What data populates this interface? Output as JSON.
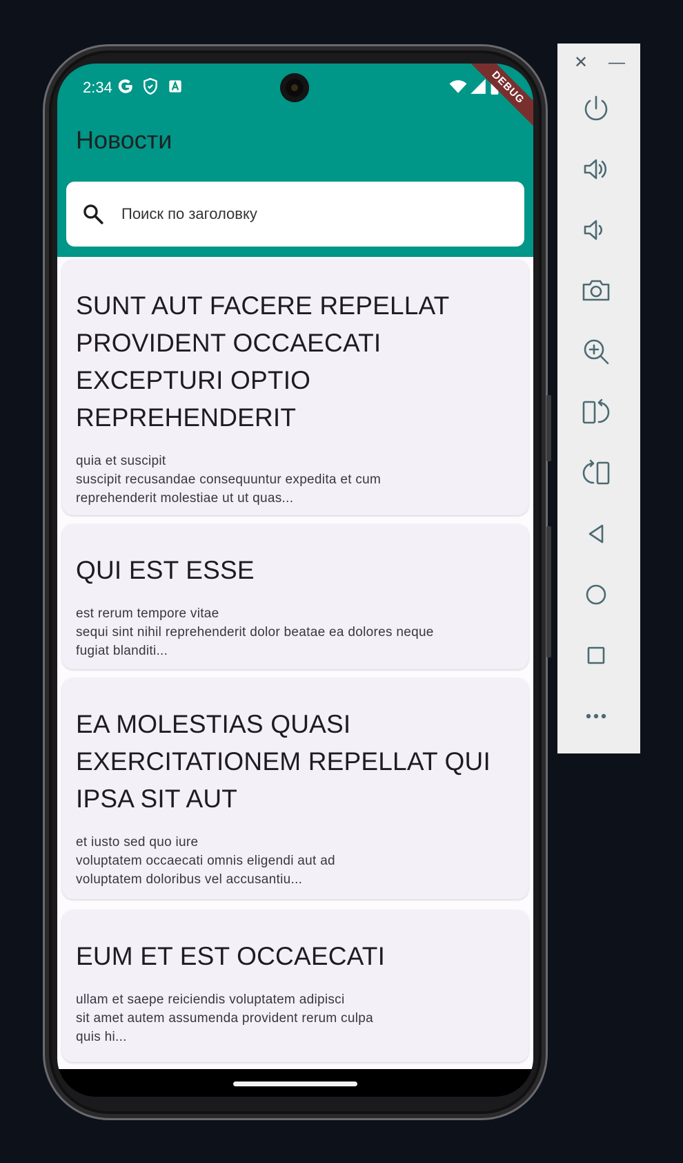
{
  "status_bar": {
    "time": "2:34",
    "icons": [
      "google-icon",
      "shield-icon",
      "font-icon",
      "wifi-icon",
      "signal-icon",
      "battery-icon"
    ],
    "debug_banner": "DEBUG"
  },
  "appbar": {
    "title": "Новости",
    "color": "#009688"
  },
  "search": {
    "placeholder": "Поиск по заголовку",
    "value": ""
  },
  "posts": [
    {
      "title": "SUNT AUT FACERE REPELLAT PROVIDENT OCCAECATI EXCEPTURI OPTIO REPREHENDERIT",
      "body": "quia et suscipit\nsuscipit recusandae consequuntur expedita et cum\nreprehenderit molestiae ut ut quas..."
    },
    {
      "title": "QUI EST ESSE",
      "body": "est rerum tempore vitae\nsequi sint nihil reprehenderit dolor beatae ea dolores neque\nfugiat blanditi..."
    },
    {
      "title": "EA MOLESTIAS QUASI EXERCITATIONEM REPELLAT QUI IPSA SIT AUT",
      "body": "et iusto sed quo iure\nvoluptatem occaecati omnis eligendi aut ad\nvoluptatem doloribus vel accusantiu..."
    },
    {
      "title": "EUM ET EST OCCAECATI",
      "body": "ullam et saepe reiciendis voluptatem adipisci\nsit amet autem assumenda provident rerum culpa\nquis hi..."
    }
  ],
  "emulator_toolbar": {
    "close_label": "✕",
    "minimize_label": "—",
    "buttons": [
      "power-icon",
      "volume-up-icon",
      "volume-down-icon",
      "camera-icon",
      "zoom-in-icon",
      "rotate-right-icon",
      "rotate-left-icon",
      "back-icon",
      "home-icon",
      "overview-icon",
      "more-icon"
    ]
  }
}
